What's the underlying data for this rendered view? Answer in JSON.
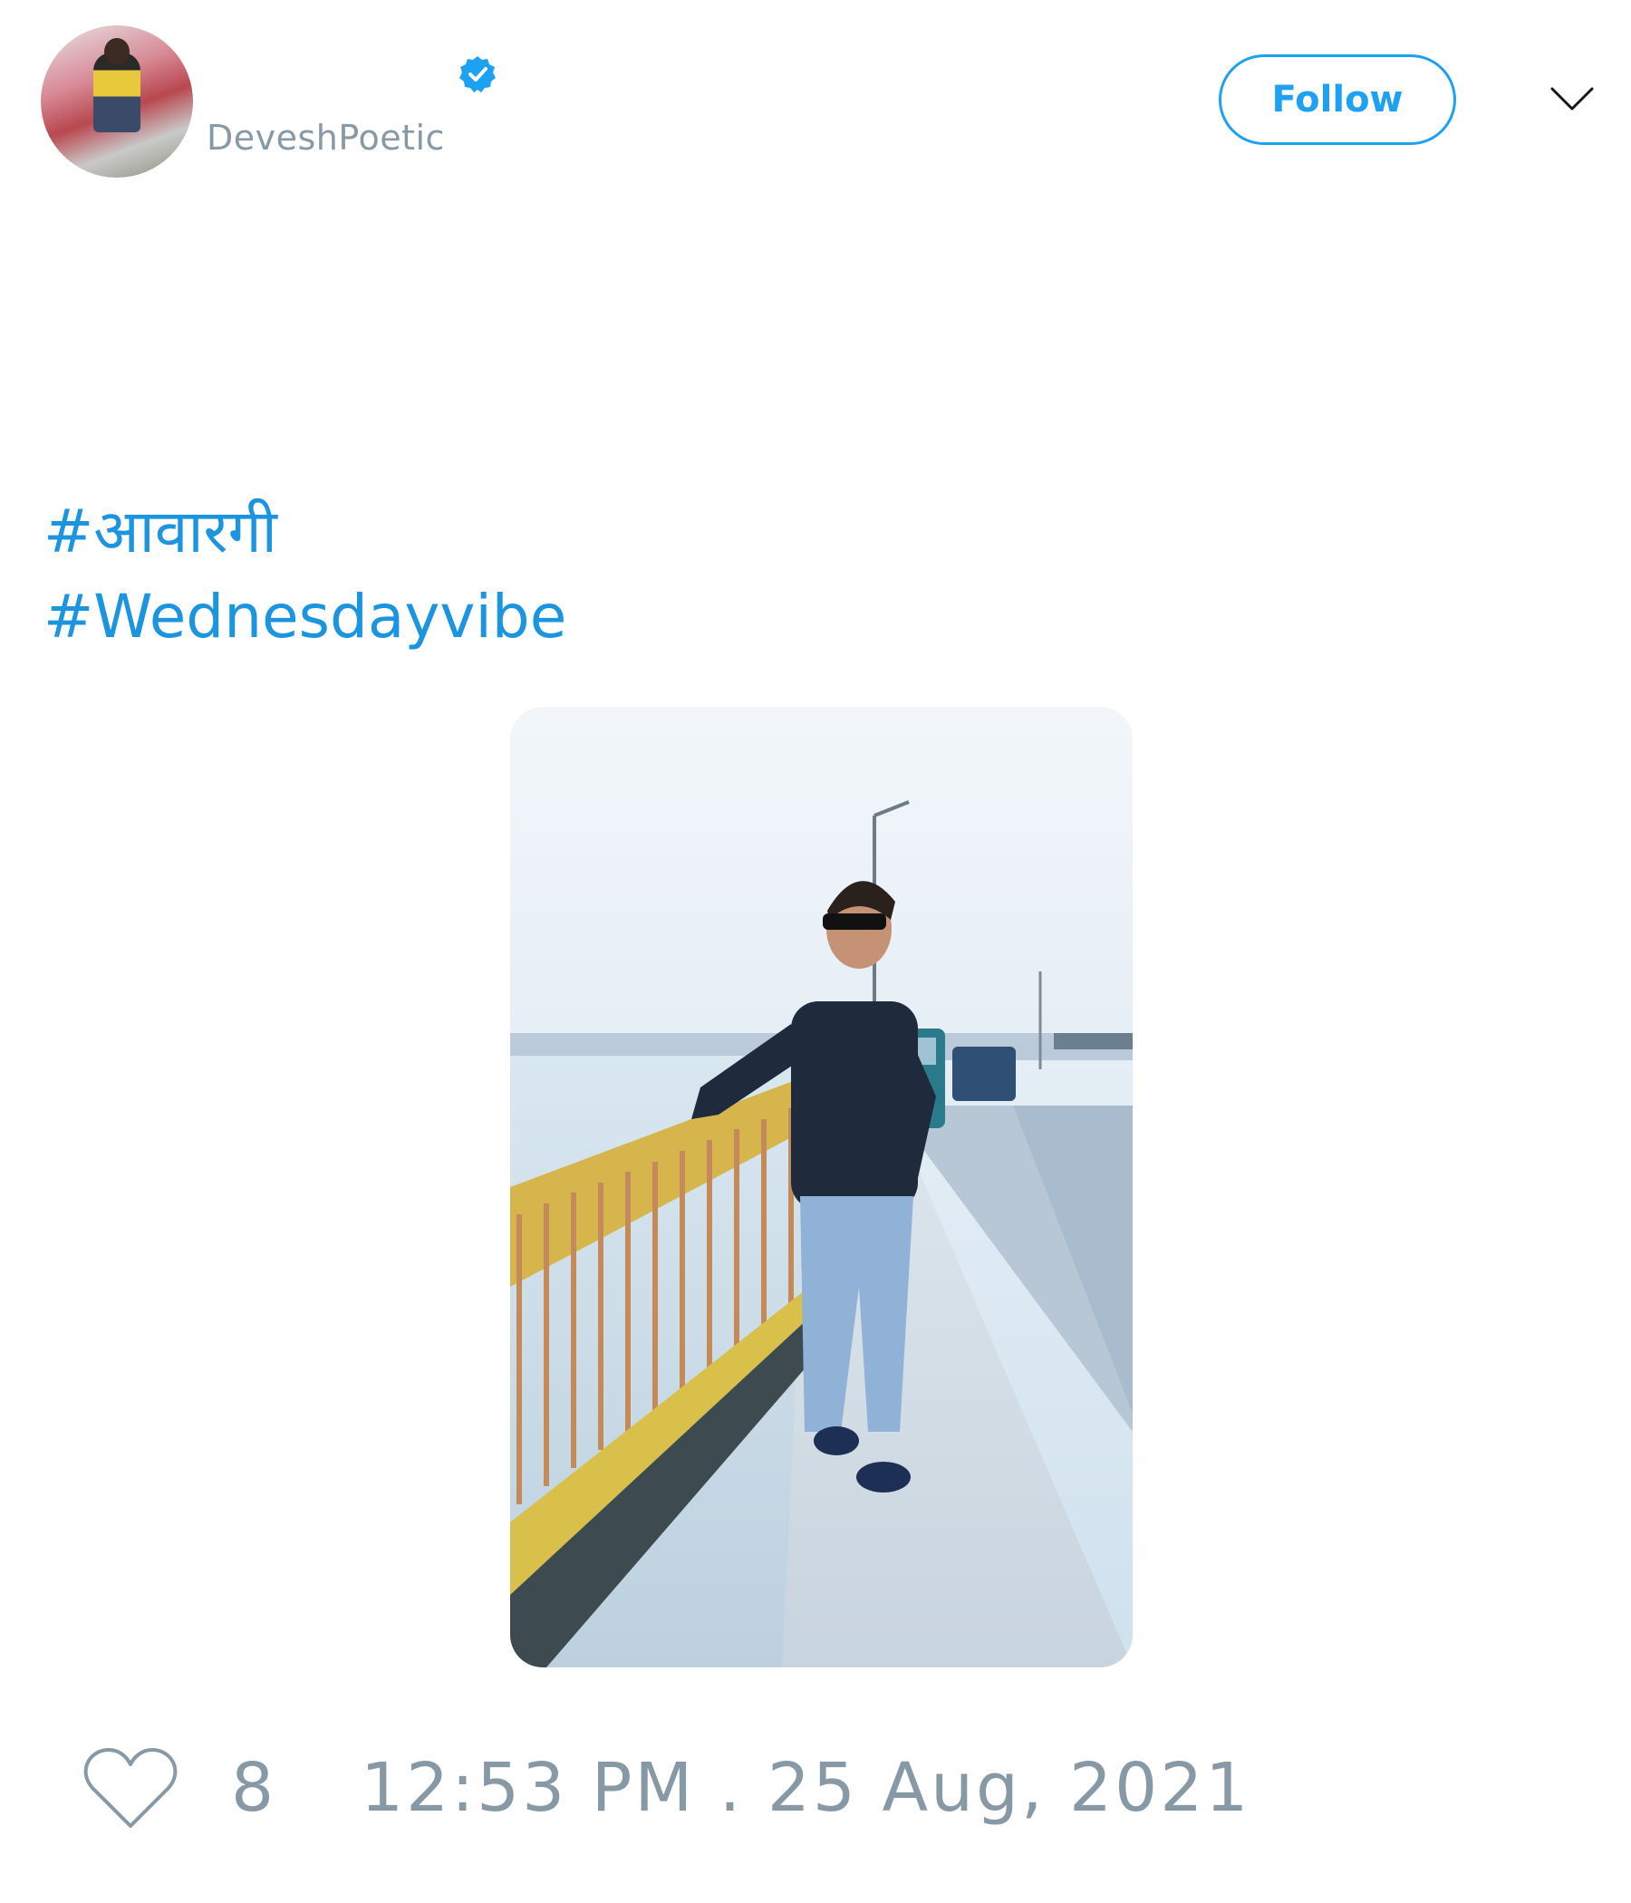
{
  "tweet": {
    "author": {
      "display_name": "",
      "username": "DeveshPoetic",
      "verified": true,
      "avatar_icon": "profile-photo"
    },
    "follow_label": "Follow",
    "menu_icon": "chevron-down-icon",
    "hashtags": [
      "#आवारगी",
      "#Wednesdayvibe"
    ],
    "media": {
      "type": "photo",
      "alt": ""
    },
    "like_icon": "heart-outline-icon",
    "like_count": "8",
    "timestamp": "12:53 PM . 25 Aug, 2021"
  },
  "colors": {
    "accent": "#1da1f2",
    "link": "#1b95e0",
    "muted": "#8899a6",
    "background": "#ffffff"
  }
}
